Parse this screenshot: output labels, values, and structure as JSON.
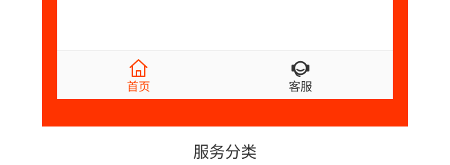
{
  "tabbar": {
    "tabs": [
      {
        "label": "首页",
        "icon": "home-icon",
        "active": true
      },
      {
        "label": "客服",
        "icon": "customer-service-icon",
        "active": false
      }
    ]
  },
  "caption": "服务分类",
  "colors": {
    "frame": "#ff3300",
    "active_tab": "#ff4500",
    "inactive_tab": "#333333",
    "tabbar_bg": "#fafafa"
  }
}
